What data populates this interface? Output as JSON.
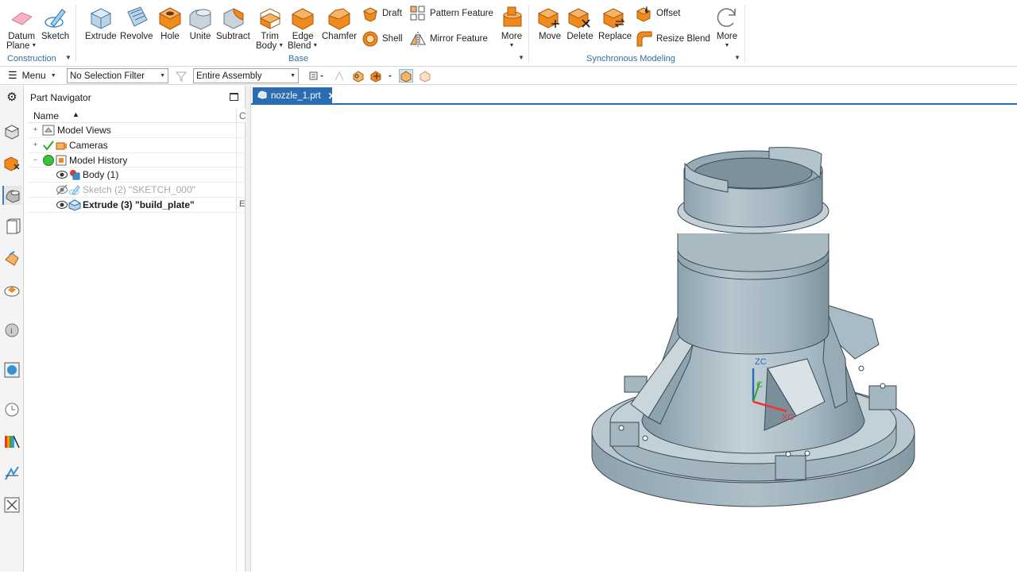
{
  "ribbon": {
    "construction": {
      "datum_plane_l1": "Datum",
      "datum_plane_l2": "Plane",
      "sketch": "Sketch",
      "group_label": "Construction"
    },
    "base": {
      "extrude": "Extrude",
      "revolve": "Revolve",
      "hole": "Hole",
      "unite": "Unite",
      "subtract": "Subtract",
      "trim_body_l1": "Trim",
      "trim_body_l2": "Body",
      "edge_blend_l1": "Edge",
      "edge_blend_l2": "Blend",
      "chamfer": "Chamfer",
      "draft": "Draft",
      "shell": "Shell",
      "pattern_feature": "Pattern Feature",
      "mirror_feature": "Mirror Feature",
      "more": "More",
      "group_label": "Base"
    },
    "sync": {
      "move": "Move",
      "delete": "Delete",
      "replace": "Replace",
      "offset": "Offset",
      "resize_blend": "Resize Blend",
      "more": "More",
      "group_label": "Synchronous Modeling"
    }
  },
  "toolbar": {
    "menu_label": "Menu",
    "selection_filter": "No Selection Filter",
    "scope": "Entire Assembly"
  },
  "navigator": {
    "title": "Part Navigator",
    "col_name": "Name",
    "col_c": "C",
    "rows": [
      {
        "label": "Model Views"
      },
      {
        "label": "Cameras"
      },
      {
        "label": "Model History"
      },
      {
        "label": "Body (1)"
      },
      {
        "label": "Sketch (2) \"SKETCH_000\""
      },
      {
        "label": "Extrude (3) \"build_plate\""
      }
    ],
    "extrude_mark": "E"
  },
  "document": {
    "tab_label": "nozzle_1.prt"
  },
  "triad": {
    "zc": "ZC",
    "xc": "XC",
    "c": "C"
  },
  "colors": {
    "accent": "#2b6db3",
    "feature_orange": "#f08a1c",
    "part_body": "#a7b9c3"
  }
}
